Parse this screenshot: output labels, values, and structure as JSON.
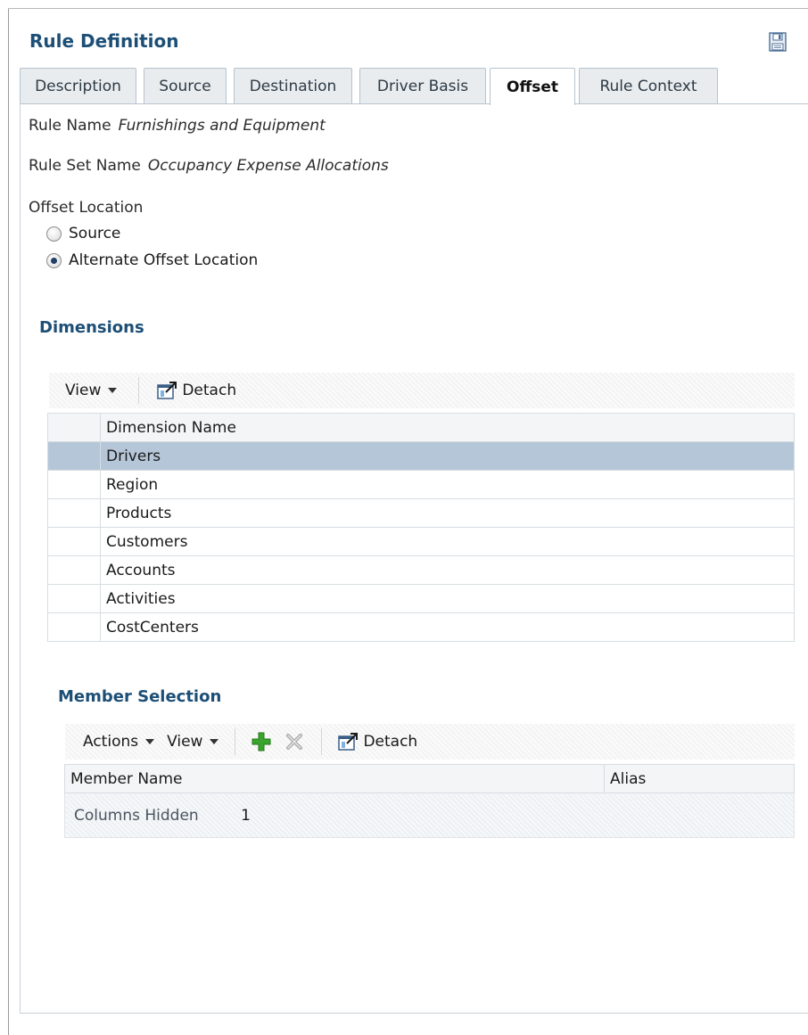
{
  "panel": {
    "title": "Rule Definition",
    "save_icon": "save-icon"
  },
  "tabs": [
    {
      "label": "Description",
      "active": false
    },
    {
      "label": "Source",
      "active": false
    },
    {
      "label": "Destination",
      "active": false
    },
    {
      "label": "Driver Basis",
      "active": false
    },
    {
      "label": "Offset",
      "active": true
    },
    {
      "label": "Rule Context",
      "active": false
    }
  ],
  "rule": {
    "name_label": "Rule Name",
    "name_value": "Furnishings and Equipment",
    "set_label": "Rule Set Name",
    "set_value": "Occupancy Expense Allocations"
  },
  "offset": {
    "label": "Offset Location",
    "options": [
      {
        "label": "Source",
        "checked": false
      },
      {
        "label": "Alternate Offset Location",
        "checked": true
      }
    ]
  },
  "dimensions": {
    "title": "Dimensions",
    "toolbar": {
      "view_label": "View",
      "detach_label": "Detach"
    },
    "column_header": "Dimension Name",
    "rows": [
      "Drivers",
      "Region",
      "Products",
      "Customers",
      "Accounts",
      "Activities",
      "CostCenters"
    ],
    "selected": "Drivers"
  },
  "members": {
    "title": "Member Selection",
    "toolbar": {
      "actions_label": "Actions",
      "view_label": "View",
      "detach_label": "Detach"
    },
    "columns": [
      "Member Name",
      "Alias"
    ],
    "hidden_label": "Columns Hidden",
    "hidden_count": "1"
  },
  "colors": {
    "accent": "#1d4f76",
    "selected_row": "#b5c6d8",
    "add_icon": "#3aa52e"
  }
}
